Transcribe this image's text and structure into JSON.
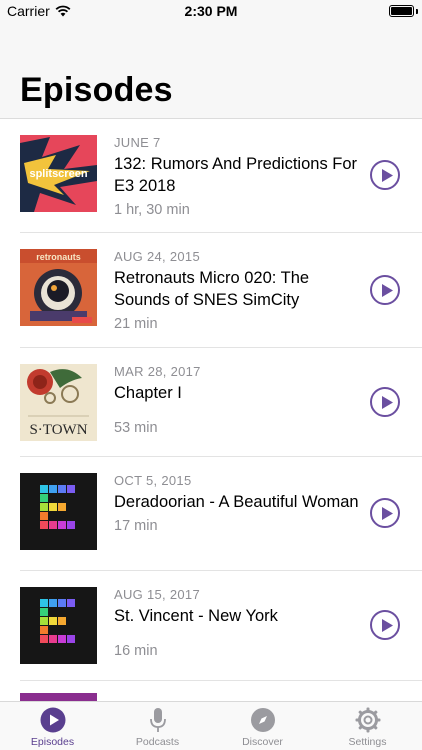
{
  "status_bar": {
    "carrier": "Carrier",
    "time": "2:30 PM"
  },
  "header": {
    "title": "Episodes"
  },
  "episodes": [
    {
      "date": "JUNE 7",
      "title": "132: Rumors And Predictions For E3 2018",
      "duration": "1 hr, 30 min",
      "art": "Splitscreen"
    },
    {
      "date": "AUG 24, 2015",
      "title": "Retronauts Micro 020: The Sounds of SNES SimCity",
      "duration": "21 min",
      "art": "Retronauts"
    },
    {
      "date": "MAR 28, 2017",
      "title": "Chapter I",
      "duration": "53 min",
      "art": "S-Town"
    },
    {
      "date": "OCT 5, 2015",
      "title": "Deradoorian - A Beautiful Woman",
      "duration": "17 min",
      "art": "Song Exploder"
    },
    {
      "date": "AUG 15, 2017",
      "title": "St. Vincent - New York",
      "duration": "16 min",
      "art": "Song Exploder"
    }
  ],
  "art_text": {
    "splitscreen": "splitscreen",
    "retronauts": "retronauts",
    "stown": "S·TOWN"
  },
  "tabs": [
    {
      "label": "Episodes",
      "icon": "play-circle-icon",
      "active": true
    },
    {
      "label": "Podcasts",
      "icon": "microphone-icon",
      "active": false
    },
    {
      "label": "Discover",
      "icon": "compass-icon",
      "active": false
    },
    {
      "label": "Settings",
      "icon": "gear-icon",
      "active": false
    }
  ],
  "colors": {
    "accent": "#5a3f8f",
    "play": "#6b4fa0",
    "secondary_text": "#8e8e93"
  }
}
